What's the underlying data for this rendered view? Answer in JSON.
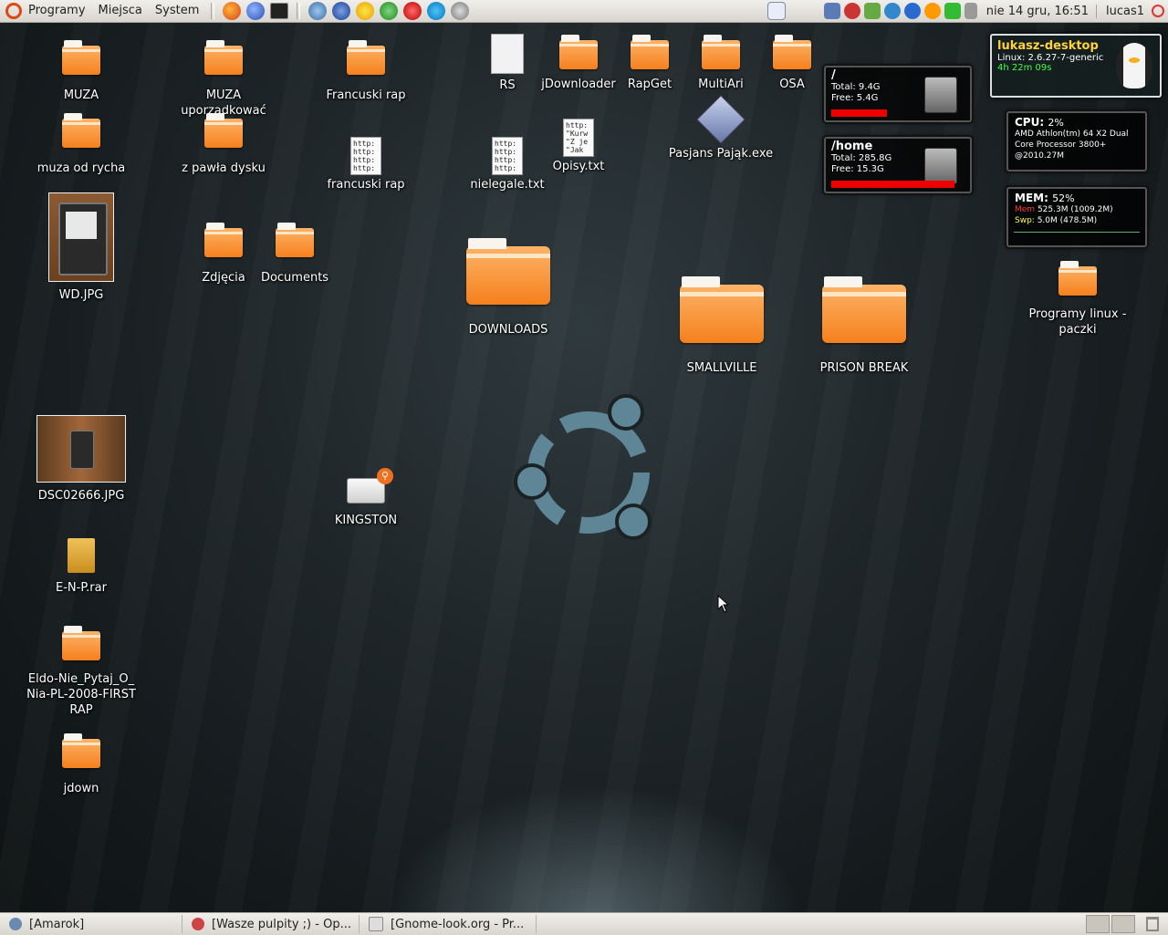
{
  "top_panel": {
    "menus": [
      "Programy",
      "Miejsca",
      "System"
    ],
    "clock": "nie 14 gru, 16:51",
    "user": "lucas1",
    "colors": {
      "accent": "#dd4814"
    }
  },
  "bottom_panel": {
    "tasks": [
      "[Amarok]",
      "[Wasze pulpity ;) - Op...",
      "[Gnome-look.org - Pr..."
    ]
  },
  "desktop": {
    "icons": {
      "muza": "MUZA",
      "muza_uporz": "MUZA uporządkować",
      "francuski_rap_folder": "Francuski rap",
      "muza_od_rycha": "muza od rycha",
      "z_pawla_dysku": "z pawła dysku",
      "francuski_rap_file": "francuski rap",
      "wd_jpg": "WD.JPG",
      "zdjecia": "Zdjęcia",
      "documents": "Documents",
      "rs": "RS",
      "jdownloader": "jDownloader",
      "rapget": "RapGet",
      "multiari": "MultiAri",
      "osa": "OSA",
      "nielegale": "nielegale.txt",
      "opisy": "Opisy.txt",
      "pasjans": "Pasjans Pająk.exe",
      "downloads": "DOWNLOADS",
      "smallville": "SMALLVILLE",
      "prison_break": "PRISON BREAK",
      "programy_linux": "Programy linux - paczki",
      "dsc": "DSC02666.JPG",
      "kingston": "KINGSTON",
      "enp": "E-N-P.rar",
      "eldo": "Eldo-Nie_Pytaj_O_Nia-PL-2008-FIRSTRAP",
      "jdown": "jdown"
    },
    "file_previews": {
      "francuski": "http:\nhttp:\nhttp:\nhttp:",
      "nielegale": "http:\nhttp:\nhttp:\nhttp:",
      "opisy": "http:\n\"Kurw\n\"Z je\n\"Jak"
    }
  },
  "conky": {
    "host": {
      "name": "lukasz-desktop",
      "kernel": "Linux: 2.6.27-7-generic",
      "uptime": "4h 22m 09s"
    },
    "root": {
      "mount": "/",
      "total": "Total: 9.4G",
      "free": "Free: 5.4G",
      "used_fraction": 0.43
    },
    "home": {
      "mount": "/home",
      "total": "Total: 285.8G",
      "free": "Free: 15.3G",
      "used_fraction": 0.95
    },
    "cpu": {
      "label": "CPU:",
      "value": "2%",
      "model": "AMD Athlon(tm) 64 X2 Dual Core Processor 3800+",
      "freq": "@2010.27M"
    },
    "mem": {
      "label": "MEM:",
      "value": "52%",
      "mem_key": "Mem",
      "mem_line": "525.3M (1009.2M)",
      "swp_key": "Swp:",
      "swp_line": "5.0M (478.5M)"
    }
  }
}
